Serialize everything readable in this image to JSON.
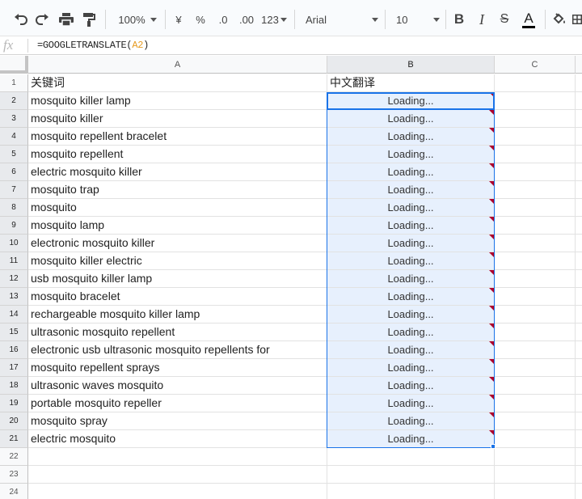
{
  "toolbar": {
    "zoom": "100%",
    "currency": "¥",
    "percent": "%",
    "dec_decrease": ".0",
    "dec_increase": ".00",
    "more_formats": "123",
    "font": "Arial",
    "font_size": "10",
    "bold": "B",
    "italic": "I",
    "strikethrough": "S",
    "text_color": "A"
  },
  "formula_bar": {
    "fx": "fx",
    "prefix": "=GOOGLETRANSLATE(",
    "ref": "A2",
    "suffix": ")"
  },
  "columns": [
    "A",
    "B",
    "C"
  ],
  "rows": [
    "1",
    "2",
    "3",
    "4",
    "5",
    "6",
    "7",
    "8",
    "9",
    "10",
    "11",
    "12",
    "13",
    "14",
    "15",
    "16",
    "17",
    "18",
    "19",
    "20",
    "21",
    "22",
    "23",
    "24"
  ],
  "header": {
    "a": "关键词",
    "b": "中文翻译"
  },
  "keywords": [
    "mosquito killer lamp",
    "mosquito killer",
    "mosquito repellent bracelet",
    "mosquito repellent",
    "electric mosquito killer",
    "mosquito trap",
    "mosquito",
    "mosquito lamp",
    "electronic mosquito killer",
    "mosquito killer electric",
    "usb mosquito killer lamp",
    "mosquito bracelet",
    "rechargeable mosquito killer lamp",
    "ultrasonic mosquito repellent",
    "electronic usb ultrasonic mosquito repellents for",
    "mosquito repellent sprays",
    "ultrasonic waves mosquito",
    "portable mosquito repeller",
    "mosquito spray",
    "electric mosquito"
  ],
  "loading_text": "Loading...",
  "colors": {
    "selection_border": "#1a73e8",
    "selection_fill": "#e7f0fd",
    "error_flag": "#b0002b",
    "ref_color": "#e69a1f"
  }
}
